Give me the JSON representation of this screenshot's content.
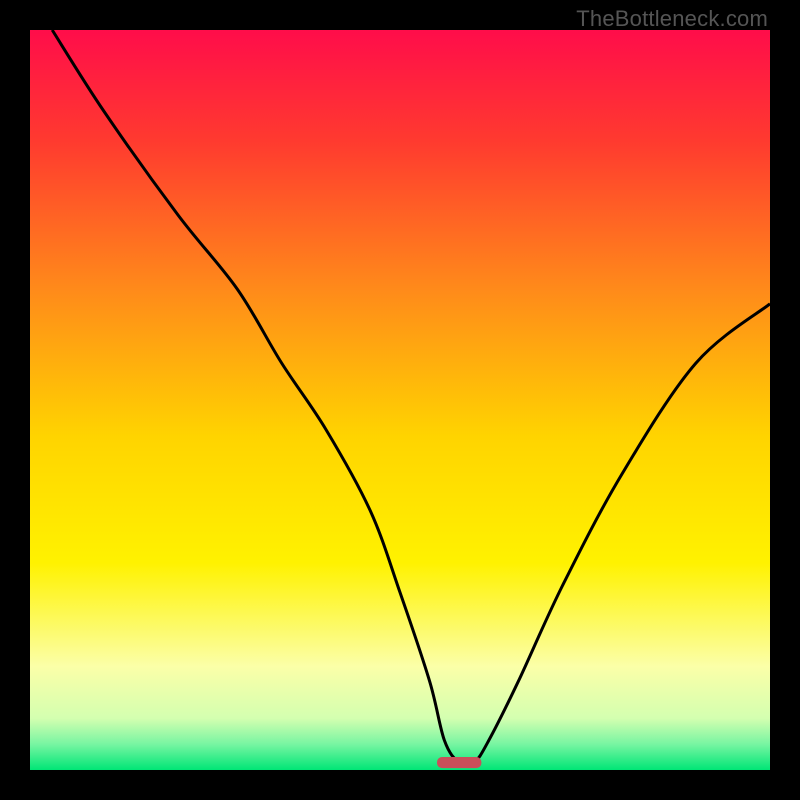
{
  "watermark": "TheBottleneck.com",
  "chart_data": {
    "type": "line",
    "title": "",
    "xlabel": "",
    "ylabel": "",
    "xlim": [
      0,
      100
    ],
    "ylim": [
      0,
      100
    ],
    "legend": false,
    "grid": false,
    "background_gradient": [
      {
        "stop": 0.0,
        "color": "#ff0d4a"
      },
      {
        "stop": 0.15,
        "color": "#ff3a2f"
      },
      {
        "stop": 0.35,
        "color": "#ff8a1a"
      },
      {
        "stop": 0.55,
        "color": "#ffd400"
      },
      {
        "stop": 0.72,
        "color": "#fff200"
      },
      {
        "stop": 0.86,
        "color": "#fbffa8"
      },
      {
        "stop": 0.93,
        "color": "#d4ffb0"
      },
      {
        "stop": 0.965,
        "color": "#78f5a2"
      },
      {
        "stop": 1.0,
        "color": "#00e676"
      }
    ],
    "marker": {
      "x": 58,
      "y": 1,
      "width": 6,
      "height": 1.5,
      "color": "#c94f5a"
    },
    "series": [
      {
        "name": "bottleneck-curve",
        "color": "#000000",
        "x": [
          3,
          10,
          20,
          28,
          34,
          40,
          46,
          50,
          54,
          56,
          58,
          60,
          62,
          66,
          72,
          80,
          90,
          100
        ],
        "values": [
          100,
          89,
          75,
          65,
          55,
          46,
          35,
          24,
          12,
          4,
          1,
          1,
          4,
          12,
          25,
          40,
          55,
          63
        ]
      }
    ]
  }
}
